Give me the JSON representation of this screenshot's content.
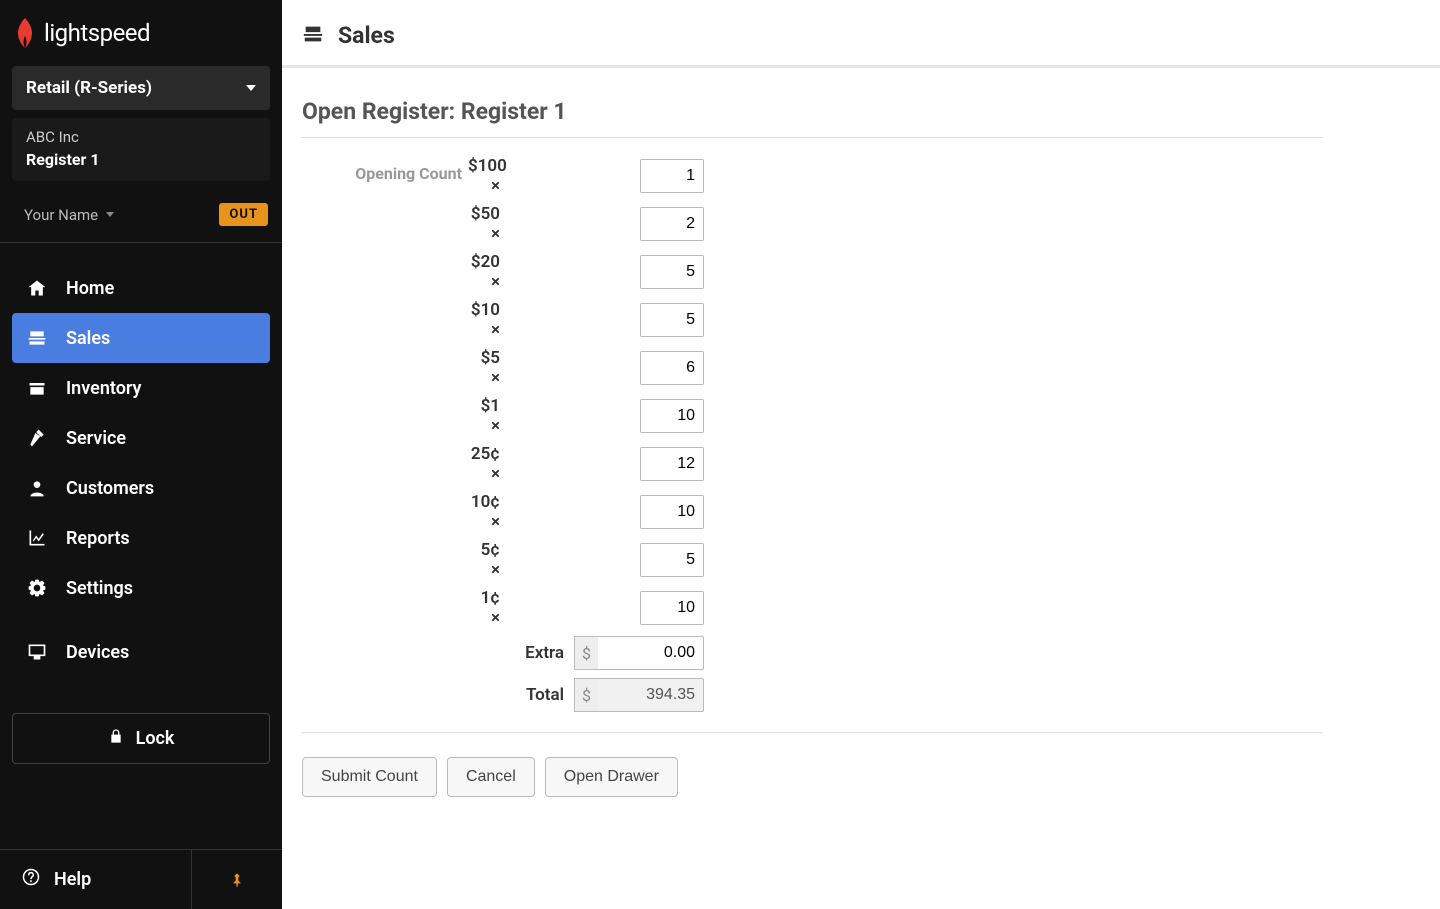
{
  "brand": "lightspeed",
  "product_selector": "Retail (R-Series)",
  "company": "ABC Inc",
  "register": "Register 1",
  "user_name": "Your Name",
  "out_badge": "OUT",
  "nav": {
    "home": "Home",
    "sales": "Sales",
    "inventory": "Inventory",
    "service": "Service",
    "customers": "Customers",
    "reports": "Reports",
    "settings": "Settings",
    "devices": "Devices"
  },
  "lock": "Lock",
  "help": "Help",
  "header": {
    "title": "Sales"
  },
  "page_title": "Open Register: Register 1",
  "opening_count_label": "Opening Count",
  "denoms": [
    {
      "label": "$100 ×",
      "value": "1"
    },
    {
      "label": "$50 ×",
      "value": "2"
    },
    {
      "label": "$20 ×",
      "value": "5"
    },
    {
      "label": "$10 ×",
      "value": "5"
    },
    {
      "label": "$5 ×",
      "value": "6"
    },
    {
      "label": "$1 ×",
      "value": "10"
    },
    {
      "label": "25¢ ×",
      "value": "12"
    },
    {
      "label": "10¢ ×",
      "value": "10"
    },
    {
      "label": "5¢ ×",
      "value": "5"
    },
    {
      "label": "1¢ ×",
      "value": "10"
    }
  ],
  "extra": {
    "label": "Extra",
    "value": "0.00"
  },
  "total": {
    "label": "Total",
    "value": "394.35"
  },
  "currency_symbol": "$",
  "buttons": {
    "submit": "Submit Count",
    "cancel": "Cancel",
    "open_drawer": "Open Drawer"
  }
}
